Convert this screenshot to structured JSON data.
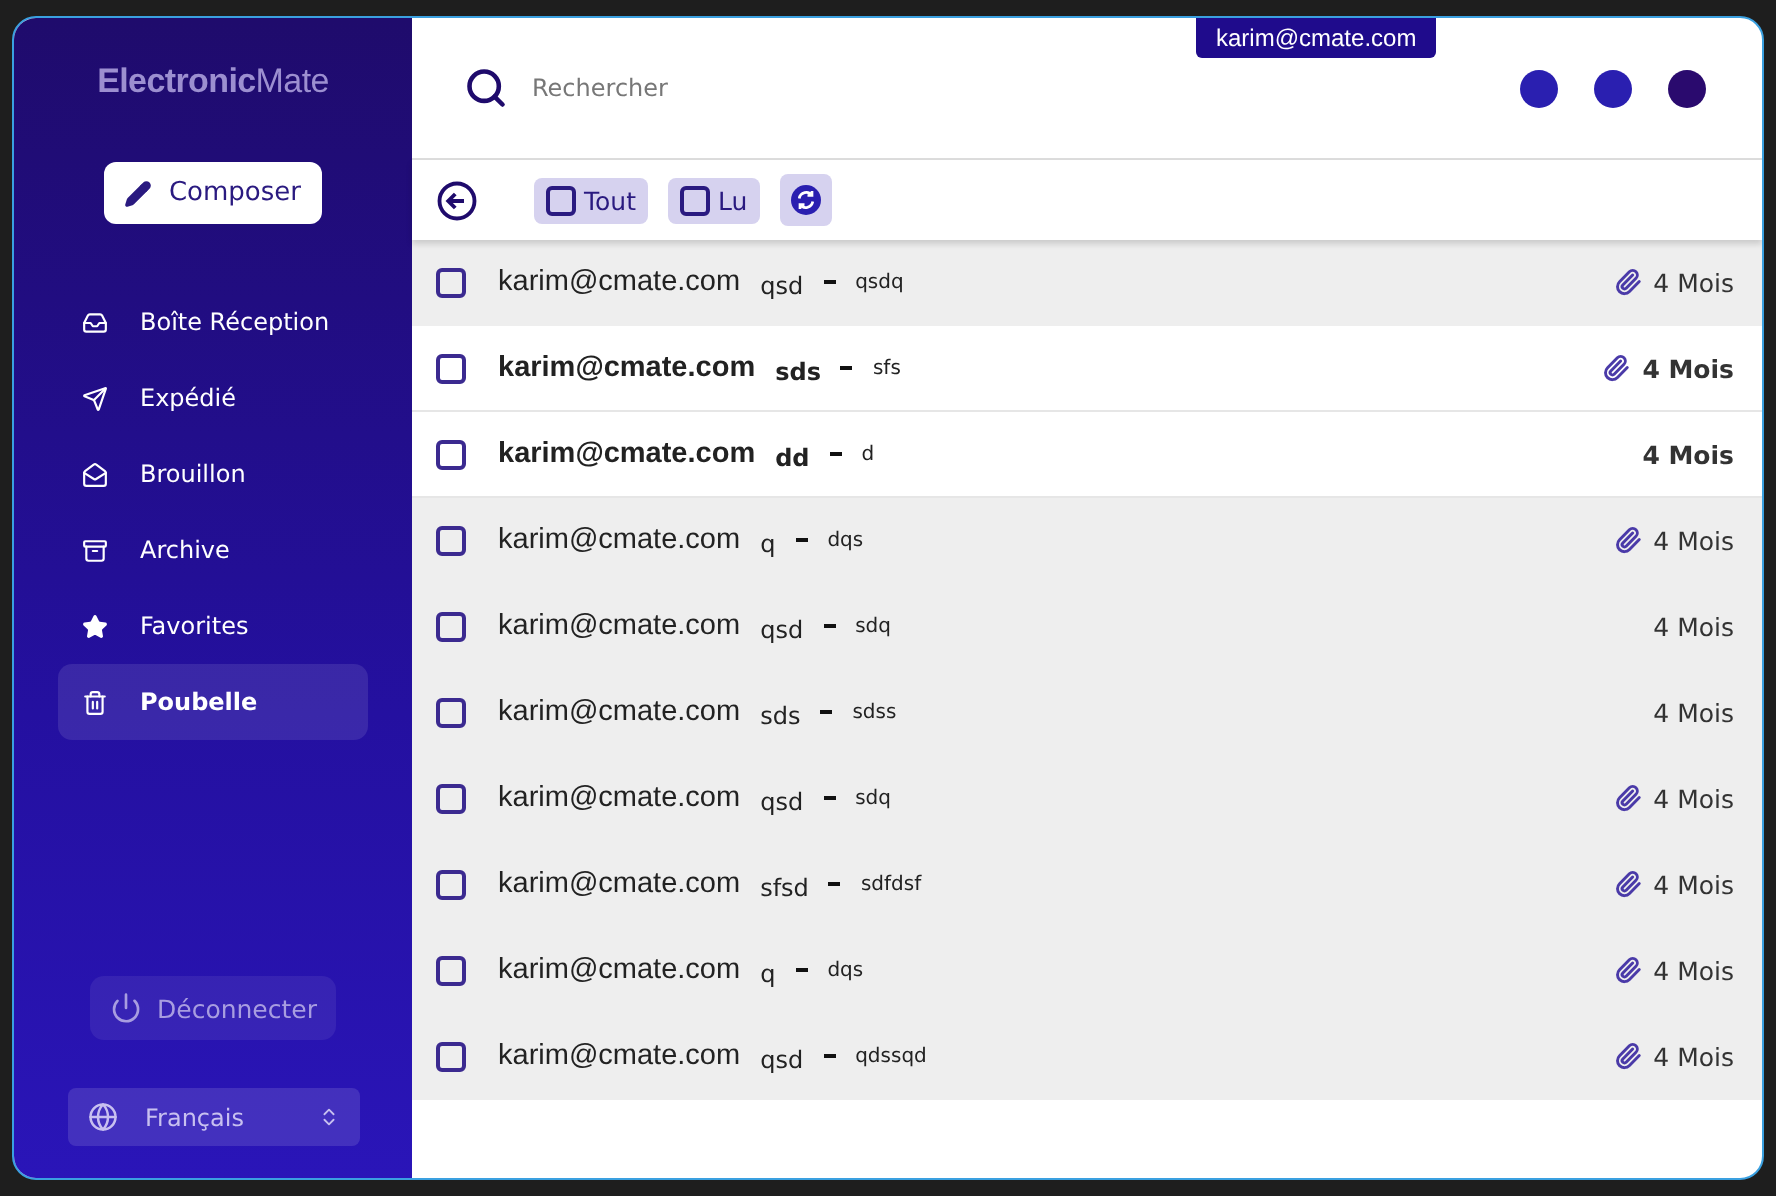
{
  "sidebar": {
    "logo": {
      "bold": "Electronic",
      "light": "Mate"
    },
    "compose_button": "Composer",
    "items": [
      {
        "label": "Boîte Réception",
        "kind": "inbox",
        "selected": false
      },
      {
        "label": "Expédié",
        "kind": "send",
        "selected": false
      },
      {
        "label": "Brouillon",
        "kind": "draft",
        "selected": false
      },
      {
        "label": "Archive",
        "kind": "archive",
        "selected": false
      },
      {
        "label": "Favorites",
        "kind": "star",
        "selected": false
      },
      {
        "label": "Poubelle",
        "kind": "trash",
        "selected": true
      }
    ],
    "logout_button": "Déconnecter",
    "language": "Français"
  },
  "header": {
    "search": {
      "placeholder": "Rechercher"
    },
    "user_tooltip": "karim@cmate.com",
    "dots": [
      {
        "color": "#2a1fb0"
      },
      {
        "color": "#2a1fb0"
      },
      {
        "color": "#2a0a6e"
      }
    ]
  },
  "toolbar": {
    "filters": [
      {
        "label": "Tout",
        "checked": false
      },
      {
        "label": "Lu",
        "checked": false
      }
    ]
  },
  "messages": [
    {
      "sender": "karim@cmate.com",
      "subject": "qsd",
      "preview": "qsdq",
      "time": "4 Mois",
      "unread": false,
      "attachment": true,
      "checked": false
    },
    {
      "sender": "karim@cmate.com",
      "subject": "sds",
      "preview": "sfs",
      "time": "4 Mois",
      "unread": true,
      "attachment": true,
      "checked": false
    },
    {
      "sender": "karim@cmate.com",
      "subject": "dd",
      "preview": "d",
      "time": "4 Mois",
      "unread": true,
      "attachment": false,
      "checked": false
    },
    {
      "sender": "karim@cmate.com",
      "subject": "q",
      "preview": "dqs",
      "time": "4 Mois",
      "unread": false,
      "attachment": true,
      "checked": false
    },
    {
      "sender": "karim@cmate.com",
      "subject": "qsd",
      "preview": "sdq",
      "time": "4 Mois",
      "unread": false,
      "attachment": false,
      "checked": false
    },
    {
      "sender": "karim@cmate.com",
      "subject": "sds",
      "preview": "sdss",
      "time": "4 Mois",
      "unread": false,
      "attachment": false,
      "checked": false
    },
    {
      "sender": "karim@cmate.com",
      "subject": "qsd",
      "preview": "sdq",
      "time": "4 Mois",
      "unread": false,
      "attachment": true,
      "checked": false
    },
    {
      "sender": "karim@cmate.com",
      "subject": "sfsd",
      "preview": "sdfdsf",
      "time": "4 Mois",
      "unread": false,
      "attachment": true,
      "checked": false
    },
    {
      "sender": "karim@cmate.com",
      "subject": "q",
      "preview": "dqs",
      "time": "4 Mois",
      "unread": false,
      "attachment": true,
      "checked": false
    },
    {
      "sender": "karim@cmate.com",
      "subject": "qsd",
      "preview": "qdssqd",
      "time": "4 Mois",
      "unread": false,
      "attachment": true,
      "checked": false
    }
  ]
}
